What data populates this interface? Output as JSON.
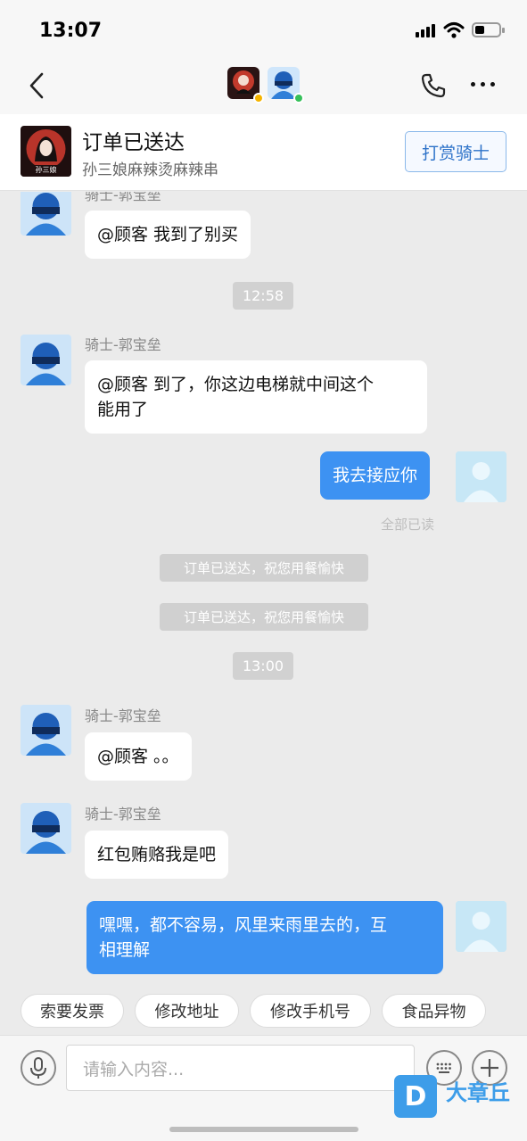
{
  "status_bar": {
    "time": "13:07"
  },
  "header": {
    "order_status": "订单已送达",
    "shop_name": "孙三娘麻辣烫麻辣串",
    "tip_button": "打赏骑士",
    "logo_text": "孙三娘"
  },
  "messages": {
    "m0_sender": "骑士-郭宝垒",
    "m0_text": "@顾客 我到了别买",
    "t1": "12:58",
    "m1_sender": "骑士-郭宝垒",
    "m1_line1": "@顾客 到了，你这边电梯就中间这个",
    "m1_line2": "能用了",
    "m2_text": "我去接应你",
    "m2_read": "全部已读",
    "sys1": "订单已送达，祝您用餐愉快",
    "sys2": "订单已送达，祝您用餐愉快",
    "t2": "13:00",
    "m3_sender": "骑士-郭宝垒",
    "m3_text": "@顾客 。。",
    "m4_sender": "骑士-郭宝垒",
    "m4_text": "红包贿赂我是吧",
    "m5_line1": "嘿嘿，都不容易，风里来雨里去的，互",
    "m5_line2": "相理解"
  },
  "quick_replies": [
    "索要发票",
    "修改地址",
    "修改手机号",
    "食品异物"
  ],
  "input": {
    "placeholder": "请输入内容..."
  },
  "watermark": {
    "letter": "D",
    "text": "大章丘"
  },
  "colors": {
    "accent_blue": "#3d92f2",
    "tip_border": "#8ab8ea",
    "online": "#36c05a",
    "away": "#f5b400"
  },
  "icons": [
    "back-icon",
    "phone-icon",
    "more-icon",
    "mic-icon",
    "keyboard-icon",
    "plus-icon",
    "helmet-avatar-icon",
    "person-avatar-icon"
  ]
}
